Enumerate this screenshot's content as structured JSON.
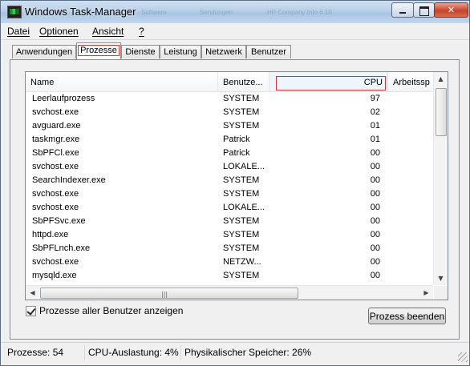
{
  "window": {
    "title": "Windows Task-Manager"
  },
  "background_titles": [
    "Software",
    "Sendungen",
    "HP Company Info 6 10"
  ],
  "title_controls": {
    "minimize_icon": "minimize-icon",
    "maximize_icon": "maximize-icon",
    "close_glyph": "✕"
  },
  "menu": [
    "Datei",
    "Optionen",
    "Ansicht",
    "?"
  ],
  "tabs": [
    {
      "label": "Anwendungen",
      "active": false
    },
    {
      "label": "Prozesse",
      "active": true
    },
    {
      "label": "Dienste",
      "active": false
    },
    {
      "label": "Leistung",
      "active": false
    },
    {
      "label": "Netzwerk",
      "active": false
    },
    {
      "label": "Benutzer",
      "active": false
    }
  ],
  "table": {
    "columns": [
      "Name",
      "Benutze...",
      "CPU",
      "Arbeitssp"
    ],
    "sorted_column": "CPU",
    "rows": [
      {
        "name": "Leerlaufprozess",
        "user": "SYSTEM",
        "cpu": "97"
      },
      {
        "name": "svchost.exe",
        "user": "SYSTEM",
        "cpu": "02"
      },
      {
        "name": "avguard.exe",
        "user": "SYSTEM",
        "cpu": "01"
      },
      {
        "name": "taskmgr.exe",
        "user": "Patrick",
        "cpu": "01"
      },
      {
        "name": "SbPFCl.exe",
        "user": "Patrick",
        "cpu": "00"
      },
      {
        "name": "svchost.exe",
        "user": "LOKALE...",
        "cpu": "00"
      },
      {
        "name": "SearchIndexer.exe",
        "user": "SYSTEM",
        "cpu": "00"
      },
      {
        "name": "svchost.exe",
        "user": "SYSTEM",
        "cpu": "00"
      },
      {
        "name": "svchost.exe",
        "user": "LOKALE...",
        "cpu": "00"
      },
      {
        "name": "SbPFSvc.exe",
        "user": "SYSTEM",
        "cpu": "00"
      },
      {
        "name": "httpd.exe",
        "user": "SYSTEM",
        "cpu": "00"
      },
      {
        "name": "SbPFLnch.exe",
        "user": "SYSTEM",
        "cpu": "00"
      },
      {
        "name": "svchost.exe",
        "user": "NETZW...",
        "cpu": "00"
      },
      {
        "name": "mysqld.exe",
        "user": "SYSTEM",
        "cpu": "00"
      }
    ]
  },
  "scroll": {
    "up": "▲",
    "down": "▼",
    "left": "◀",
    "right": "▶",
    "grip": "|||"
  },
  "checkbox": {
    "label": "Prozesse aller Benutzer anzeigen",
    "checked": true
  },
  "end_button": "Prozess beenden",
  "status": {
    "processes": "Prozesse: 54",
    "cpu": "CPU-Auslastung: 4%",
    "memory": "Physikalischer Speicher: 26%"
  }
}
